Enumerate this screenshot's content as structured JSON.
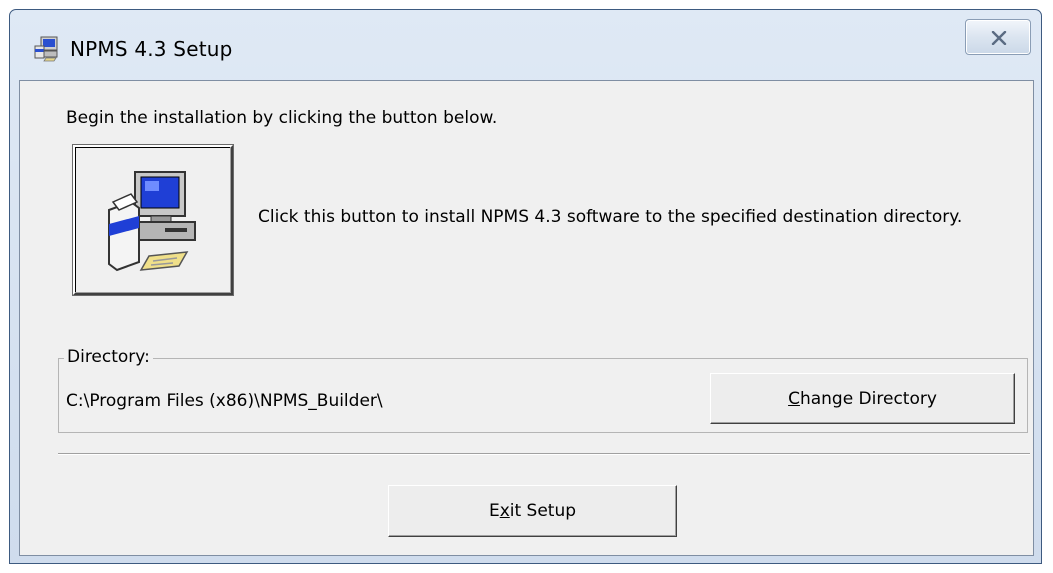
{
  "window": {
    "title": "NPMS 4.3 Setup",
    "close_icon": "close-icon"
  },
  "main": {
    "intro": "Begin the installation by clicking the button below.",
    "install_button_icon": "computer-install-icon",
    "install_description": "Click this button to install NPMS 4.3 software to the specified destination directory."
  },
  "directory": {
    "legend": "Directory:",
    "path": "C:\\Program Files (x86)\\NPMS_Builder\\",
    "change_button": {
      "accel": "C",
      "rest": "hange Directory"
    }
  },
  "footer": {
    "exit_button": {
      "before": "E",
      "accel": "x",
      "after": "it Setup"
    }
  }
}
